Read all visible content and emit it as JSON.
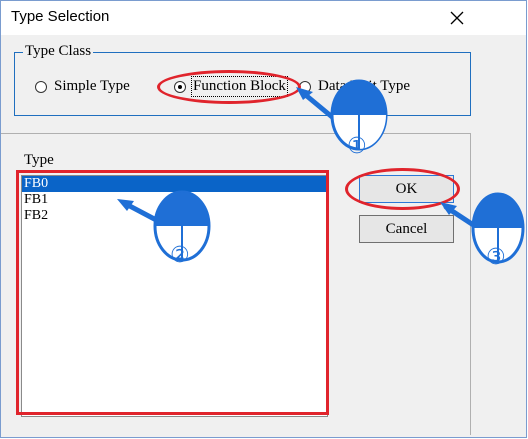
{
  "window": {
    "title": "Type Selection",
    "close_glyph": "✕"
  },
  "type_class": {
    "legend": "Type Class",
    "options": [
      {
        "label": "Simple Type",
        "checked": false
      },
      {
        "label": "Function Block",
        "checked": true
      },
      {
        "label": "Data Unit Type",
        "checked": false
      }
    ]
  },
  "type_list": {
    "label": "Type",
    "items": [
      "FB0",
      "FB1",
      "FB2"
    ],
    "selected_index": 0
  },
  "buttons": {
    "ok": "OK",
    "cancel": "Cancel"
  },
  "annotations": {
    "step1": "①",
    "step2": "②",
    "step3": "③",
    "highlight_color": "#e0242c",
    "pointer_color": "#1f6fd6"
  }
}
